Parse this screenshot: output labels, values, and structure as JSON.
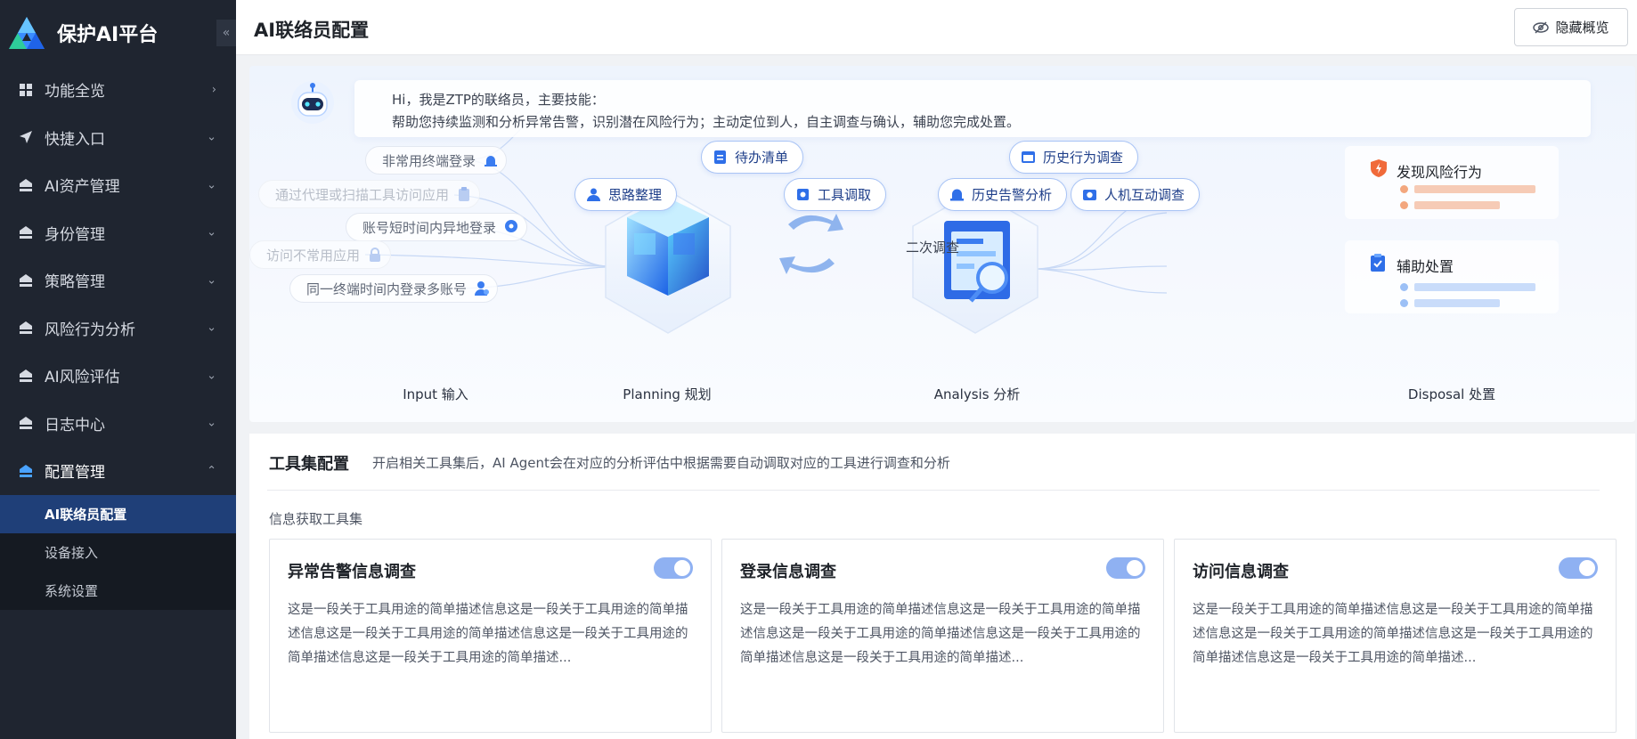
{
  "app": {
    "name": "保护AI平台",
    "collapse_glyph": "«"
  },
  "sidebar": {
    "items": [
      {
        "label": "功能全览",
        "icon": "grid-icon",
        "chevron": "›"
      },
      {
        "label": "快捷入口",
        "icon": "send-icon",
        "chevron": "⌄"
      },
      {
        "label": "AI资产管理",
        "icon": "home-icon",
        "chevron": "⌄"
      },
      {
        "label": "身份管理",
        "icon": "home-icon",
        "chevron": "⌄"
      },
      {
        "label": "策略管理",
        "icon": "home-icon",
        "chevron": "⌄"
      },
      {
        "label": "风险行为分析",
        "icon": "home-icon",
        "chevron": "⌄"
      },
      {
        "label": "AI风险评估",
        "icon": "home-icon",
        "chevron": "⌄"
      },
      {
        "label": "日志中心",
        "icon": "home-icon",
        "chevron": "⌄"
      },
      {
        "label": "配置管理",
        "icon": "home-icon",
        "chevron": "⌃"
      }
    ],
    "subitems": [
      {
        "label": "AI联络员配置",
        "active": true
      },
      {
        "label": "设备接入",
        "active": false
      },
      {
        "label": "系统设置",
        "active": false
      }
    ]
  },
  "header": {
    "title": "AI联络员配置",
    "hide_button": "隐藏概览"
  },
  "overview": {
    "intro_line1": "Hi，我是ZTP的联络员，主要技能：",
    "intro_line2": "帮助您持续监测和分析异常告警，识别潜在风险行为；主动定位到人，自主调查与确认，辅助您完成处置。",
    "inputs": [
      {
        "label": "非常用终端登录",
        "faded": false
      },
      {
        "label": "通过代理或扫描工具访问应用",
        "faded": true
      },
      {
        "label": "账号短时间内异地登录",
        "faded": false
      },
      {
        "label": "访问不常用应用",
        "faded": true
      },
      {
        "label": "同一终端时间内登录多账号",
        "faded": false
      }
    ],
    "planning_chips": [
      "待办清单",
      "思路整理",
      "工具调取"
    ],
    "analysis_chips": [
      "历史行为调查",
      "历史告警分析",
      "人机互动调查"
    ],
    "second_investigation": "二次调查",
    "results": [
      "发现风险行为",
      "辅助处置"
    ],
    "stages": [
      "Input 输入",
      "Planning 规划",
      "Analysis 分析",
      "Disposal 处置"
    ]
  },
  "tools": {
    "title": "工具集配置",
    "desc": "开启相关工具集后，AI Agent会在对应的分析评估中根据需要自动调取对应的工具进行调查和分析",
    "group_label": "信息获取工具集",
    "cards": [
      {
        "name": "异常告警信息调查",
        "enabled": true,
        "desc": "这是一段关于工具用途的简单描述信息这是一段关于工具用途的简单描述信息这是一段关于工具用途的简单描述信息这是一段关于工具用途的简单描述信息这是一段关于工具用途的简单描述..."
      },
      {
        "name": "登录信息调查",
        "enabled": true,
        "desc": "这是一段关于工具用途的简单描述信息这是一段关于工具用途的简单描述信息这是一段关于工具用途的简单描述信息这是一段关于工具用途的简单描述信息这是一段关于工具用途的简单描述..."
      },
      {
        "name": "访问信息调查",
        "enabled": true,
        "desc": "这是一段关于工具用途的简单描述信息这是一段关于工具用途的简单描述信息这是一段关于工具用途的简单描述信息这是一段关于工具用途的简单描述信息这是一段关于工具用途的简单描述..."
      }
    ]
  },
  "colors": {
    "sidebar_bg": "#1f2530",
    "active_sub": "#1f3f78",
    "accent": "#3370ff",
    "toggle_on": "#8fb1f2"
  }
}
